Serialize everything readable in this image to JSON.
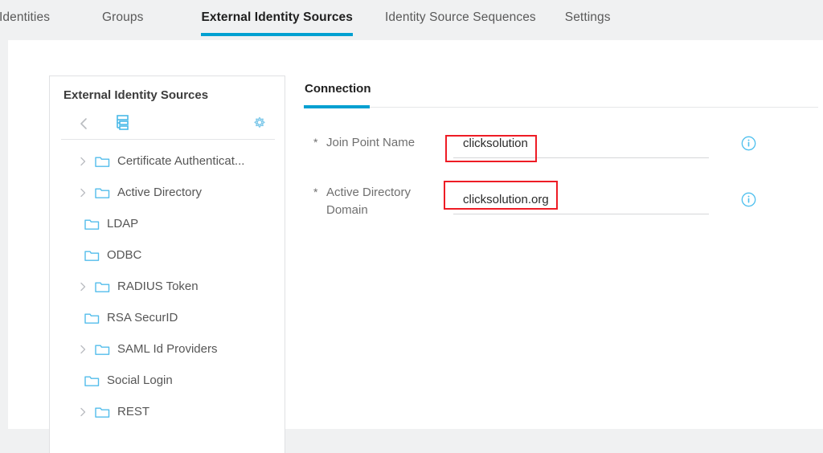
{
  "topnav": {
    "tabs": [
      {
        "label": "Identities",
        "active": false
      },
      {
        "label": "Groups",
        "active": false
      },
      {
        "label": "External Identity Sources",
        "active": true
      },
      {
        "label": "Identity Source Sequences",
        "active": false
      },
      {
        "label": "Settings",
        "active": false
      }
    ],
    "active_accent": "#00a0d1"
  },
  "left_panel": {
    "title": "External Identity Sources",
    "toolbar": {
      "back_icon": "chevron-left-icon",
      "tree_icon": "hierarchy-tree-icon",
      "settings_icon": "gear-icon"
    },
    "tree": [
      {
        "label": "Certificate Authenticat...",
        "has_caret": true
      },
      {
        "label": "Active Directory",
        "has_caret": true
      },
      {
        "label": "LDAP",
        "has_caret": false
      },
      {
        "label": "ODBC",
        "has_caret": false
      },
      {
        "label": "RADIUS Token",
        "has_caret": true
      },
      {
        "label": "RSA SecurID",
        "has_caret": false
      },
      {
        "label": "SAML Id Providers",
        "has_caret": true
      },
      {
        "label": "Social Login",
        "has_caret": false
      },
      {
        "label": "REST",
        "has_caret": true
      }
    ]
  },
  "right_panel": {
    "tab": {
      "label": "Connection",
      "active": true
    },
    "fields": [
      {
        "required_marker": "*",
        "label": "Join Point Name",
        "value": "clicksolution",
        "placeholder": "",
        "info_icon": "info-circle-icon",
        "highlighted": true
      },
      {
        "required_marker": "*",
        "label": "Active Directory Domain",
        "value": "clicksolution.org",
        "placeholder": "",
        "info_icon": "info-circle-icon",
        "highlighted": true
      }
    ]
  },
  "annotations": {
    "highlight_color": "#ee1c25",
    "boxes": [
      {
        "target": "join-point-name-field"
      },
      {
        "target": "active-directory-domain-field"
      }
    ]
  }
}
